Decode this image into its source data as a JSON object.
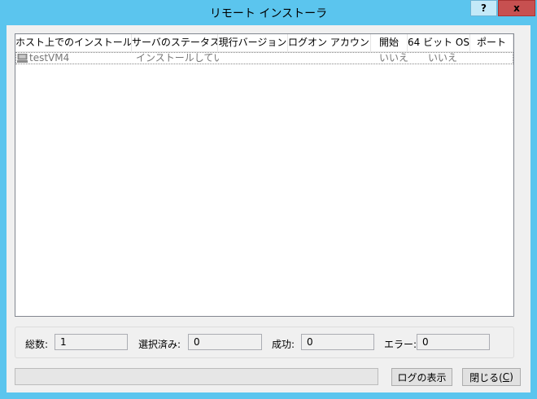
{
  "window": {
    "title": "リモート インストーラ",
    "help_label": "?",
    "close_label": "x"
  },
  "list": {
    "columns": [
      "ホスト上でのインストール",
      "サーバのステータス",
      "現行バージョン",
      "ログオン アカウント",
      "開始",
      "64 ビット OS",
      "ポート"
    ],
    "rows": [
      {
        "host": "testVM4",
        "status": "インストールしてい…",
        "version": "",
        "logon": "",
        "start": "いいえ",
        "os64": "いいえ",
        "port": ""
      }
    ]
  },
  "summary": {
    "total_label": "総数:",
    "total_value": "1",
    "selected_label": "選択済み:",
    "selected_value": "0",
    "success_label": "成功:",
    "success_value": "0",
    "error_label": "エラー:",
    "error_value": "0"
  },
  "progress": {
    "fraction": 0
  },
  "buttons": {
    "show_log": "ログの表示",
    "close_prefix": "閉じる(",
    "close_key": "C",
    "close_suffix": ")"
  },
  "colors": {
    "titlebar": "#5bc5ee",
    "close_button": "#c75050",
    "dialog_bg": "#f0f0f0"
  },
  "icons": {
    "host": "computer-icon"
  }
}
